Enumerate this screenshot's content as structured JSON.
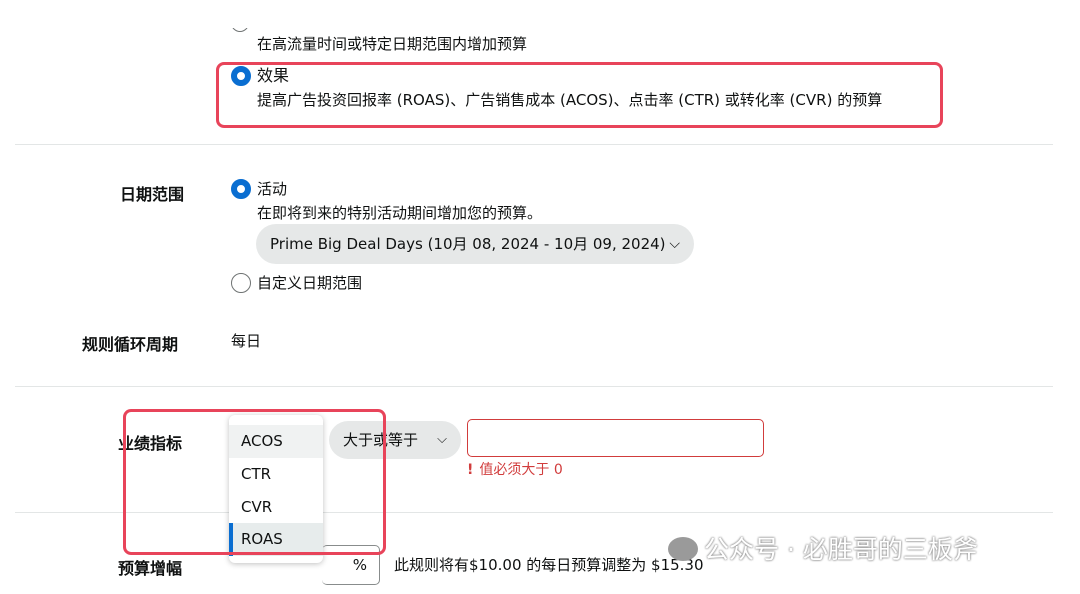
{
  "budget_type": {
    "top_description": "在高流量时间或特定日期范围内增加预算",
    "performance": {
      "label": "效果",
      "description": "提高广告投资回报率 (ROAS)、广告销售成本 (ACOS)、点击率 (CTR) 或转化率 (CVR) 的预算"
    }
  },
  "date_range": {
    "label": "日期范围",
    "event_option": {
      "label": "活动",
      "description": "在即将到来的特别活动期间增加您的预算。",
      "event_select": "Prime Big Deal Days (10月 08, 2024 - 10月 09, 2024)"
    },
    "custom_option": {
      "label": "自定义日期范围"
    }
  },
  "recurrence": {
    "label": "规则循环周期",
    "value": "每日"
  },
  "metric": {
    "label": "业绩指标",
    "options": [
      "ACOS",
      "CTR",
      "CVR",
      "ROAS"
    ],
    "selected": "ROAS",
    "condition": "大于或等于",
    "error": "值必须大于 0"
  },
  "budget_increase": {
    "label": "预算增幅",
    "unit": "%",
    "note": "此规则将有$10.00 的每日预算调整为 $15.30"
  },
  "watermark": "公众号 · 必胜哥的三板斧",
  "colors": {
    "accent": "#0a6ed1",
    "highlight": "#e8445a",
    "error": "#d13c3c"
  }
}
